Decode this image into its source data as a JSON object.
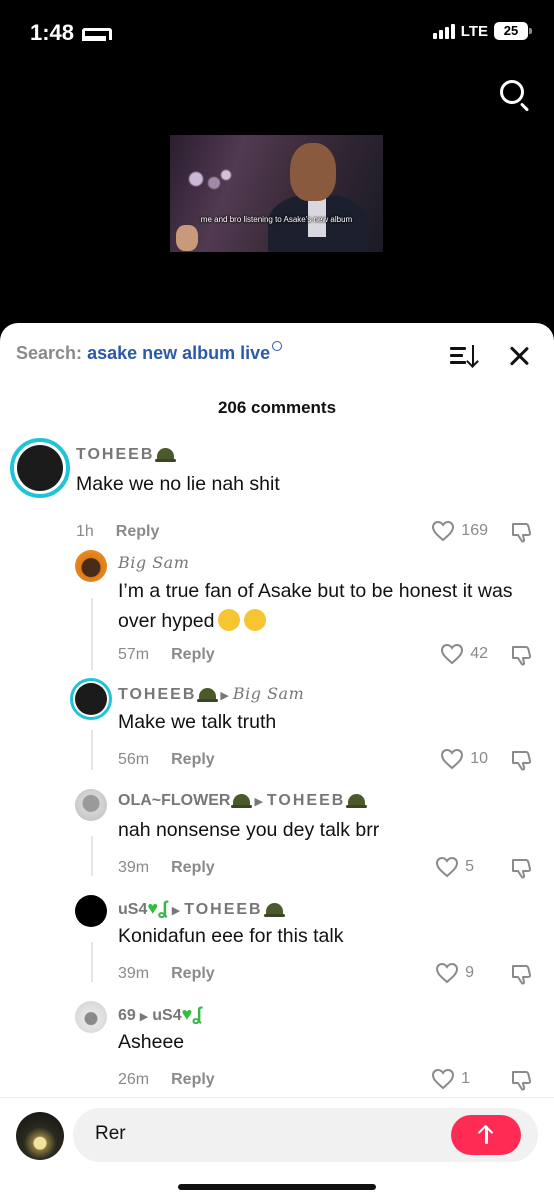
{
  "status": {
    "time": "1:48",
    "network": "LTE",
    "battery": "25"
  },
  "video": {
    "caption": "me and bro listening to Asake's new album"
  },
  "search": {
    "prefix": "Search:",
    "query": "asake new album live"
  },
  "comments_count": "206 comments",
  "comments": [
    {
      "user": "TOHEEB",
      "text": "Make we no lie nah shit",
      "time": "1h",
      "reply": "Reply",
      "likes": "169"
    },
    {
      "user": "Big Sam",
      "text": "I’m a true fan of Asake but to be honest it was over hyped",
      "time": "57m",
      "reply": "Reply",
      "likes": "42"
    },
    {
      "user": "TOHEEB",
      "reply_to": "Big Sam",
      "text": "Make we talk truth",
      "time": "56m",
      "reply": "Reply",
      "likes": "10"
    },
    {
      "user": "OLA~FLOWER",
      "reply_to": "TOHEEB",
      "text": "nah nonsense you dey talk brr",
      "time": "39m",
      "reply": "Reply",
      "likes": "5"
    },
    {
      "user": "uS4",
      "reply_to": "TOHEEB",
      "text": "Konidafun eee for this talk",
      "time": "39m",
      "reply": "Reply",
      "likes": "9"
    },
    {
      "user": "69",
      "reply_to": "uS4",
      "text": "Asheee",
      "time": "26m",
      "reply": "Reply",
      "likes": "1"
    }
  ],
  "composer": {
    "value": "Rer"
  },
  "colors": {
    "accent": "#fe2c55",
    "link": "#2d5aa8",
    "teal_ring": "#20c4d8"
  },
  "icons": [
    "bed-icon",
    "search-icon",
    "sort-icon",
    "close-icon",
    "heart-icon",
    "dislike-icon",
    "send-arrow-icon",
    "helmet-emoji"
  ]
}
